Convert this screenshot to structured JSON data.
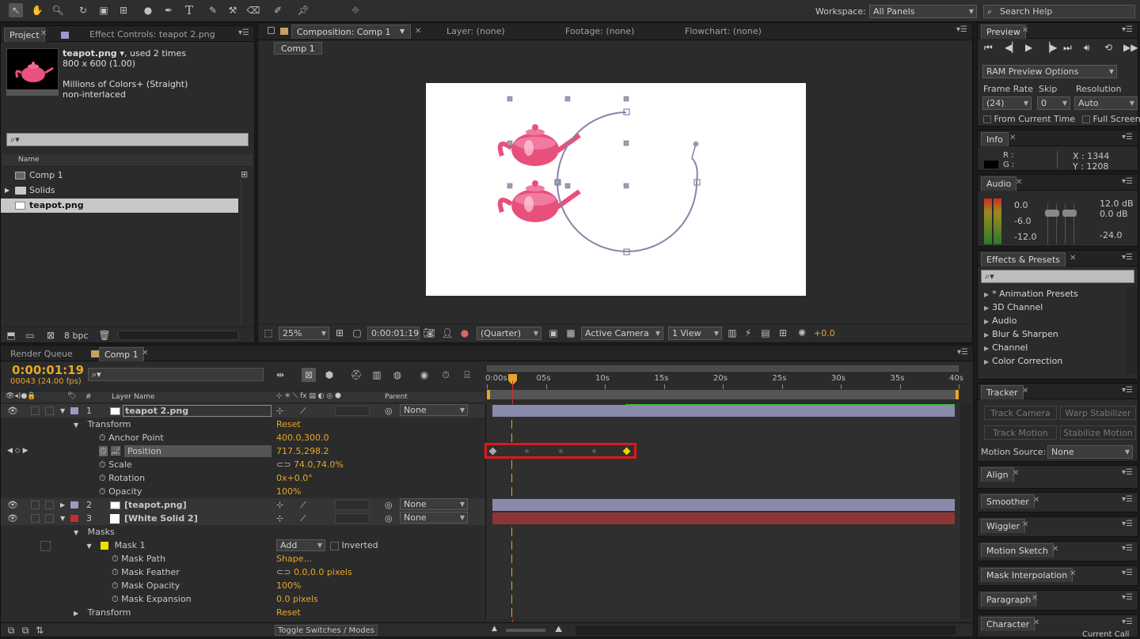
{
  "toolbar": {
    "workspace_label": "Workspace:",
    "workspace_value": "All Panels",
    "search_placeholder": "Search Help"
  },
  "project": {
    "tab_project": "Project",
    "tab_effects": "Effect Controls: teapot 2.png",
    "file_name": "teapot.png ▾",
    "used": ", used 2 times",
    "dims": "800 x 600 (1.00)",
    "colors": "Millions of Colors+ (Straight)",
    "interlace": "non-interlaced",
    "col_name": "Name",
    "items": [
      "Comp 1",
      "Solids",
      "teapot.png"
    ],
    "bpc": "8 bpc"
  },
  "composition": {
    "tab_comp": "Composition: Comp 1",
    "tab_layer": "Layer: (none)",
    "tab_footage": "Footage: (none)",
    "tab_flowchart": "Flowchart: (none)",
    "comp_button": "Comp 1",
    "zoom": "25%",
    "timecode": "0:00:01:19",
    "quality": "(Quarter)",
    "camera": "Active Camera",
    "views": "1 View",
    "exposure": "+0.0"
  },
  "timeline": {
    "tab_render": "Render Queue",
    "tab_comp": "Comp 1",
    "timecode": "0:00:01:19",
    "frames": "00043 (24.00 fps)",
    "col_layer_name": "Layer Name",
    "col_parent": "Parent",
    "col_hash": "#",
    "ruler": [
      "0:00s",
      "05s",
      "10s",
      "15s",
      "20s",
      "25s",
      "30s",
      "35s",
      "40s"
    ],
    "layers": [
      {
        "num": "1",
        "name": "teapot 2.png",
        "parent": "None"
      },
      {
        "num": "2",
        "name": "[teapot.png]",
        "parent": "None"
      },
      {
        "num": "3",
        "name": "[White Solid 2]",
        "parent": "None"
      }
    ],
    "props": {
      "transform": "Transform",
      "reset": "Reset",
      "anchor": "Anchor Point",
      "anchor_val": "400.0,300.0",
      "position": "Position",
      "position_val": "717.5,298.2",
      "scale": "Scale",
      "scale_val": "74.0,74.0%",
      "rotation": "Rotation",
      "rotation_val": "0x+0.0°",
      "opacity": "Opacity",
      "opacity_val": "100%",
      "masks": "Masks",
      "mask1": "Mask 1",
      "mask_mode": "Add",
      "inverted": "Inverted",
      "mask_path": "Mask Path",
      "mask_path_val": "Shape...",
      "mask_feather": "Mask Feather",
      "mask_feather_val": "0.0,0.0 pixels",
      "mask_opacity": "Mask Opacity",
      "mask_opacity_val": "100%",
      "mask_expansion": "Mask Expansion",
      "mask_expansion_val": "0.0 pixels",
      "transform2": "Transform",
      "reset2": "Reset"
    },
    "toggle": "Toggle Switches / Modes"
  },
  "right": {
    "preview": "Preview",
    "ram_options": "RAM Preview Options",
    "frame_rate_label": "Frame Rate",
    "skip_label": "Skip",
    "resolution_label": "Resolution",
    "frame_rate": "(24)",
    "skip": "0",
    "resolution": "Auto",
    "from_current": "From Current Time",
    "full_screen": "Full Screen",
    "info": "Info",
    "info_r": "R :",
    "info_g": "G :",
    "info_x": "X : 1344",
    "info_y": "Y : 1208",
    "audio": "Audio",
    "audio_left": [
      "0.0",
      "-6.0",
      "-12.0"
    ],
    "audio_right": [
      "12.0 dB",
      "0.0 dB",
      "-24.0"
    ],
    "effects": "Effects & Presets",
    "effects_list": [
      "* Animation Presets",
      "3D Channel",
      "Audio",
      "Blur & Sharpen",
      "Channel",
      "Color Correction"
    ],
    "tracker": "Tracker",
    "track_camera": "Track Camera",
    "warp_stabilizer": "Warp Stabilizer",
    "track_motion": "Track Motion",
    "stabilize_motion": "Stabilize Motion",
    "motion_source_label": "Motion Source:",
    "motion_source": "None",
    "align": "Align",
    "smoother": "Smoother",
    "wiggler": "Wiggler",
    "motion_sketch": "Motion Sketch",
    "mask_interpolation": "Mask Interpolation",
    "paragraph": "Paragraph",
    "character": "Character",
    "current_call": "Current Call"
  }
}
